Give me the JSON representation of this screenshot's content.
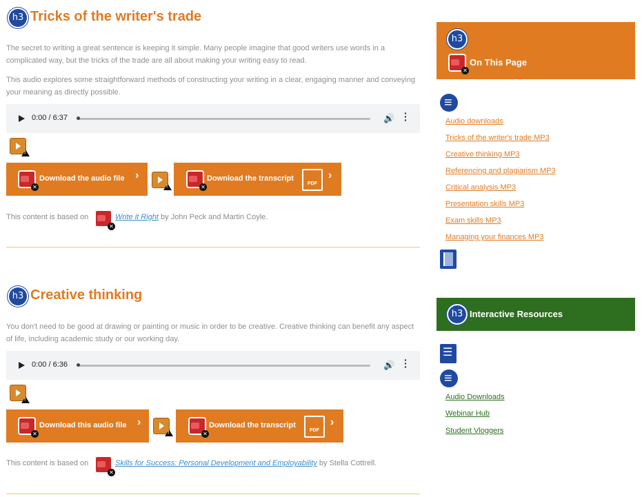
{
  "section1": {
    "badge": "h3",
    "title": "Tricks of the writer's trade",
    "para1": "The secret to writing a great sentence is keeping it simple. Many people imagine that good writers use words in a complicated way, but the tricks of the trade are all about making your writing easy to read.",
    "para2": "This audio explores some straightforward methods of constructing your writing in a clear, engaging manner and conveying your meaning as directly possible.",
    "audio_time": "0:00 / 6:37",
    "download_audio_label": "Download the audio file",
    "download_transcript_label": "Download the transcript",
    "based_on_prefix": "This content is based on",
    "book_title": "Write it Right",
    "book_authors": "by John Peck and Martin Coyle."
  },
  "section2": {
    "badge": "h3",
    "title": "Creative thinking",
    "para1": "You don't need to be good at drawing or painting or music in order to be creative. Creative thinking can benefit any aspect of life, including academic study or our working day.",
    "audio_time": "0:00 / 6:36",
    "download_audio_label": "Download this audio file",
    "download_transcript_label": "Download the transcript",
    "based_on_prefix": "This content is based on",
    "book_title": "Skills for Success: Personal Development and Employability",
    "book_authors": "by Stella Cottrell."
  },
  "sidebar": {
    "on_this_page": {
      "badge": "h3",
      "title": "On This Page",
      "links": [
        "Audio downloads",
        "Tricks of the writer's trade MP3",
        "Creative thinking MP3",
        "Referencing and plagiarism MP3",
        "Critical analysis MP3",
        "Presentation skills MP3",
        "Exam skills MP3",
        "Managing your finances MP3"
      ]
    },
    "interactive": {
      "badge": "h3",
      "title": "Interactive Resources",
      "links": [
        "Audio Downloads",
        "Webinar Hub",
        "Student Vloggers"
      ]
    }
  },
  "icons": {
    "pdf_text": "PDF"
  },
  "colors": {
    "accent_orange": "#e07b22",
    "heading_blue": "#1f4aa0",
    "sidebar_green": "#2e6e1f",
    "link_blue": "#3a8fc8"
  }
}
